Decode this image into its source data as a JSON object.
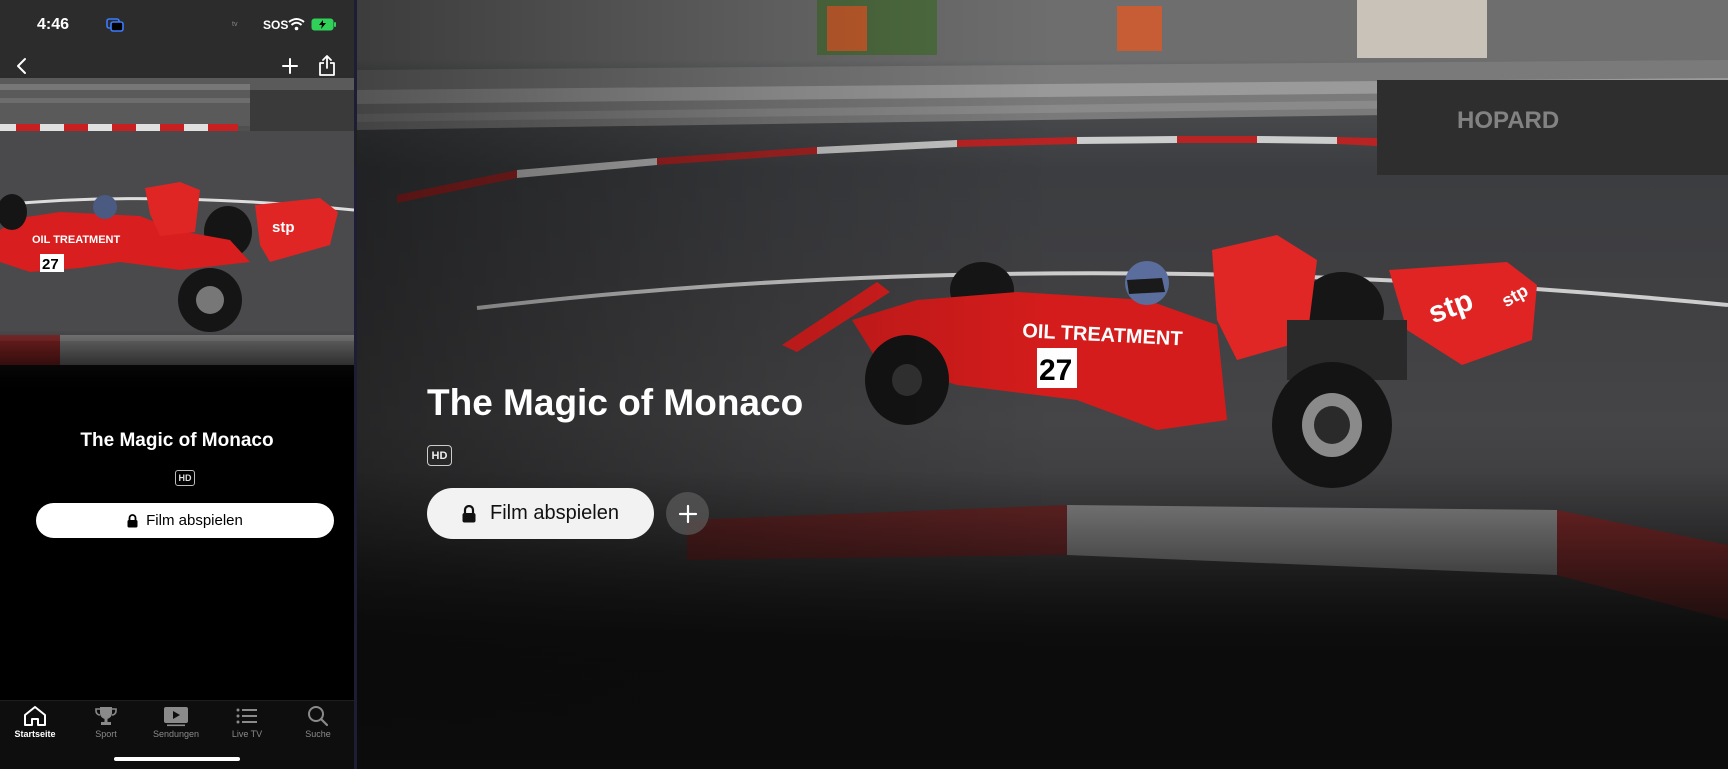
{
  "status_bar": {
    "time": "4:46",
    "carrier": "SOS",
    "tv_label": "tv"
  },
  "phone": {
    "title": "The Magic of Monaco",
    "badge": "HD",
    "play_button": "Film abspielen",
    "hero_image": "race-car-image",
    "nav": {
      "back_icon": "chevron-left-icon",
      "add_icon": "plus-icon",
      "share_icon": "share-icon"
    }
  },
  "tabbar": {
    "items": [
      {
        "label": "Startseite",
        "icon": "home-icon",
        "active": true
      },
      {
        "label": "Sport",
        "icon": "trophy-icon",
        "active": false
      },
      {
        "label": "Sendungen",
        "icon": "play-icon",
        "active": false
      },
      {
        "label": "Live TV",
        "icon": "list-icon",
        "active": false
      },
      {
        "label": "Suche",
        "icon": "search-icon",
        "active": false
      }
    ]
  },
  "main": {
    "title": "The Magic of Monaco",
    "badge": "HD",
    "play_button": "Film abspielen",
    "hero_image": "race-car-image",
    "car_number": "27",
    "car_livery_text": "OIL TREATMENT",
    "sponsor": "STP"
  },
  "colors": {
    "car_red": "#d81e1e",
    "background": "#000000",
    "button_bg": "#ffffff"
  }
}
